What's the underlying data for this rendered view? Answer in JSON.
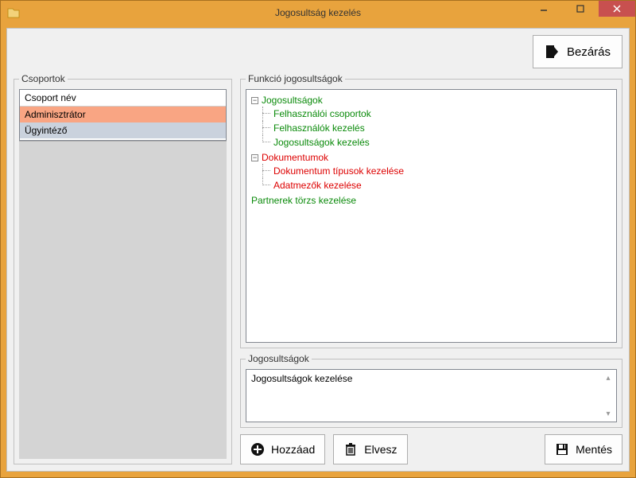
{
  "window": {
    "title": "Jogosultság kezelés"
  },
  "buttons": {
    "close_window": "Bezárás",
    "add": "Hozzáad",
    "remove": "Elvesz",
    "save": "Mentés"
  },
  "groups_panel": {
    "legend": "Csoportok",
    "column_header": "Csoport név",
    "rows": [
      "Adminisztrátor",
      "Ügyintéző"
    ]
  },
  "functions_panel": {
    "legend": "Funkció jogosultságok",
    "tree": {
      "jogosultsagok": {
        "label": "Jogosultságok",
        "children": {
          "felhasznaloi_csoportok": "Felhasználói csoportok",
          "felhasznalok_kezeles": "Felhasználók kezelés",
          "jogosultsagok_kezeles": "Jogosultságok kezelés"
        }
      },
      "dokumentumok": {
        "label": "Dokumentumok",
        "children": {
          "dokumentum_tipusok": "Dokumentum típusok kezelése",
          "adatmezok": "Adatmezők kezelése"
        }
      },
      "partnerek": "Partnerek törzs kezelése"
    }
  },
  "permissions_panel": {
    "legend": "Jogosultságok",
    "value": "Jogosultságok kezelése"
  }
}
